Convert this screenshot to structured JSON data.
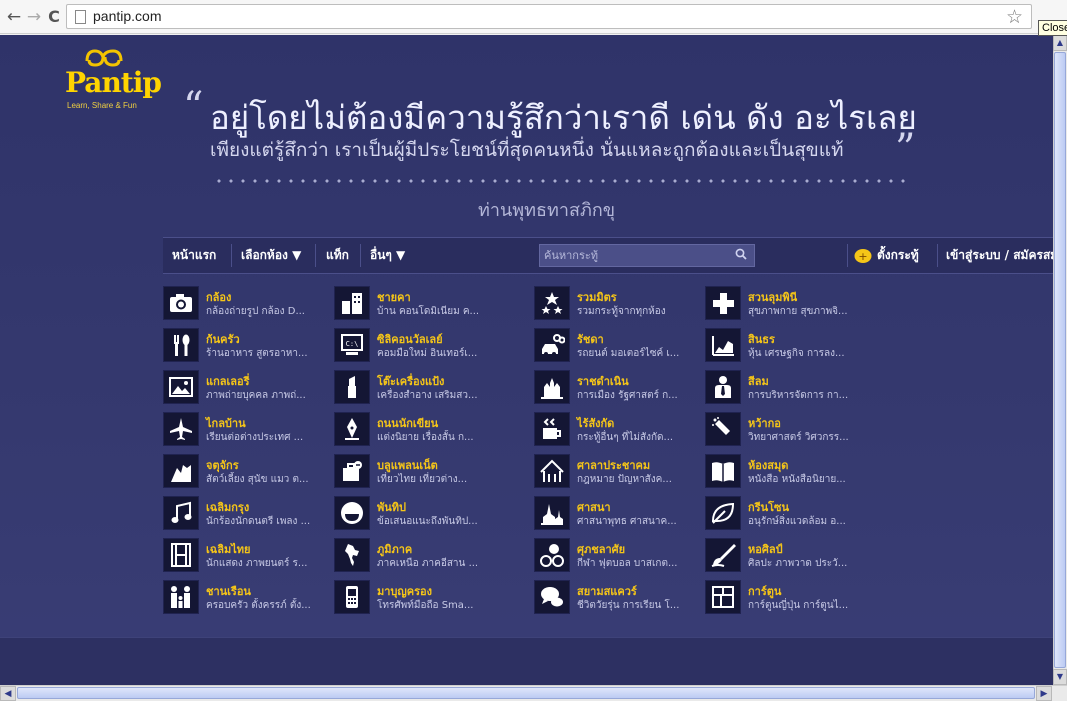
{
  "browser": {
    "back_glyph": "←",
    "forward_glyph": "→",
    "reload_glyph": "C",
    "url": "pantip.com",
    "star_glyph": "☆",
    "close_tooltip": "Close"
  },
  "header": {
    "logo_text": "Pantip",
    "logo_tagline": "Learn, Share & Fun",
    "quote_open": "“",
    "quote_line1": "อยู่โดยไม่ต้องมีความรู้สึกว่าเราดี เด่น ดัง อะไรเลย",
    "quote_line2": "เพียงแต่รู้สึกว่า เราเป็นผู้มีประโยชน์ที่สุดคนหนึ่ง นั่นแหละถูกต้องและเป็นสุขแท้",
    "quote_close": "”",
    "quote_author": "ท่านพุทธทาสภิกขุ"
  },
  "nav": {
    "home": "หน้าแรก",
    "select_room": "เลือกห้อง ▼",
    "tag": "แท็ก",
    "others": "อื่นๆ ▼",
    "search_placeholder": "ค้นหากระทู้",
    "post": "ตั้งกระทู้",
    "login": "เข้าสู่ระบบ / สมัครสมาชิก"
  },
  "rooms": [
    {
      "name": "กล้อง",
      "desc": "กล้องถ่ายรูป กล้อง D...",
      "icon": "camera-icon"
    },
    {
      "name": "ชายคา",
      "desc": "บ้าน คอนโดมิเนียม ค...",
      "icon": "building-icon"
    },
    {
      "name": "รวมมิตร",
      "desc": "รวมกระทู้จากทุกห้อง",
      "icon": "stars-icon"
    },
    {
      "name": "สวนลุมพินี",
      "desc": "สุขภาพกาย สุขภาพจิ...",
      "icon": "health-cross-icon"
    },
    {
      "name": "ก้นครัว",
      "desc": "ร้านอาหาร สูตรอาหา...",
      "icon": "fork-spoon-icon"
    },
    {
      "name": "ซิลิคอนวัลเลย์",
      "desc": "คอมมือใหม่ อินเทอร์เ...",
      "icon": "computer-icon"
    },
    {
      "name": "รัชดา",
      "desc": "รถยนต์ มอเตอร์ไซค์ เ...",
      "icon": "car-bike-icon"
    },
    {
      "name": "สินธร",
      "desc": "หุ้น เศรษฐกิจ การลง...",
      "icon": "stock-chart-icon"
    },
    {
      "name": "แกลเลอรี่",
      "desc": "ภาพถ่ายบุคคล ภาพถ่...",
      "icon": "gallery-icon"
    },
    {
      "name": "โต๊ะเครื่องแป้ง",
      "desc": "เครื่องสำอาง เสริมสว...",
      "icon": "lipstick-icon"
    },
    {
      "name": "ราชดำเนิน",
      "desc": "การเมือง รัฐศาสตร์ ก...",
      "icon": "monument-icon"
    },
    {
      "name": "สีลม",
      "desc": "การบริหารจัดการ กา...",
      "icon": "businessman-icon"
    },
    {
      "name": "ไกลบ้าน",
      "desc": "เรียนต่อต่างประเทศ ...",
      "icon": "airplane-icon"
    },
    {
      "name": "ถนนนักเขียน",
      "desc": "แต่งนิยาย เรื่องสั้น ก...",
      "icon": "pen-nib-icon"
    },
    {
      "name": "ไร้สังกัด",
      "desc": "กระทู้อื่นๆ ที่ไม่สังกัด...",
      "icon": "coffee-icon"
    },
    {
      "name": "หว้ากอ",
      "desc": "วิทยาศาสตร์ วิศวกรร...",
      "icon": "test-tube-icon"
    },
    {
      "name": "จตุจักร",
      "desc": "สัตว์เลี้ยง สุนัข แมว ต...",
      "icon": "pets-icon"
    },
    {
      "name": "บลูแพลนเน็ต",
      "desc": "เที่ยวไทย เที่ยวต่าง...",
      "icon": "luggage-icon"
    },
    {
      "name": "ศาลาประชาคม",
      "desc": "กฎหมาย ปัญหาสังค...",
      "icon": "pavilion-icon"
    },
    {
      "name": "ห้องสมุด",
      "desc": "หนังสือ หนังสือนิยาย...",
      "icon": "book-icon"
    },
    {
      "name": "เฉลิมกรุง",
      "desc": "นักร้องนักดนตรี เพลง ...",
      "icon": "music-note-icon"
    },
    {
      "name": "พันทิป",
      "desc": "ข้อเสนอแนะถึงพันทิป...",
      "icon": "pantip-smile-icon"
    },
    {
      "name": "ศาสนา",
      "desc": "ศาสนาพุทธ ศาสนาค...",
      "icon": "temple-icon"
    },
    {
      "name": "กรีนโซน",
      "desc": "อนุรักษ์สิ่งแวดล้อม อ...",
      "icon": "leaf-icon"
    },
    {
      "name": "เฉลิมไทย",
      "desc": "นักแสดง ภาพยนตร์ ร...",
      "icon": "film-icon"
    },
    {
      "name": "ภูมิภาค",
      "desc": "ภาคเหนือ ภาคอีสาน ...",
      "icon": "thailand-map-icon"
    },
    {
      "name": "ศุภชลาศัย",
      "desc": "กีฬา ฟุตบอล บาสเกต...",
      "icon": "sports-balls-icon"
    },
    {
      "name": "หอศิลป์",
      "desc": "ศิลปะ ภาพวาด ประวั...",
      "icon": "paint-brush-icon"
    },
    {
      "name": "ชานเรือน",
      "desc": "ครอบครัว ตั้งครรภ์ ตั้ง...",
      "icon": "family-icon"
    },
    {
      "name": "มาบุญครอง",
      "desc": "โทรศัพท์มือถือ Sma...",
      "icon": "mobile-phone-icon"
    },
    {
      "name": "สยามสแควร์",
      "desc": "ชีวิตวัยรุ่น การเรียน โ...",
      "icon": "chat-bubbles-icon"
    },
    {
      "name": "การ์ตูน",
      "desc": "การ์ตูนญี่ปุ่น การ์ตูนไ...",
      "icon": "comic-panel-icon"
    }
  ],
  "colors": {
    "background": "#33376d",
    "room_name": "#f5c518",
    "room_desc": "#c8cae6",
    "logo": "#ffd400"
  }
}
